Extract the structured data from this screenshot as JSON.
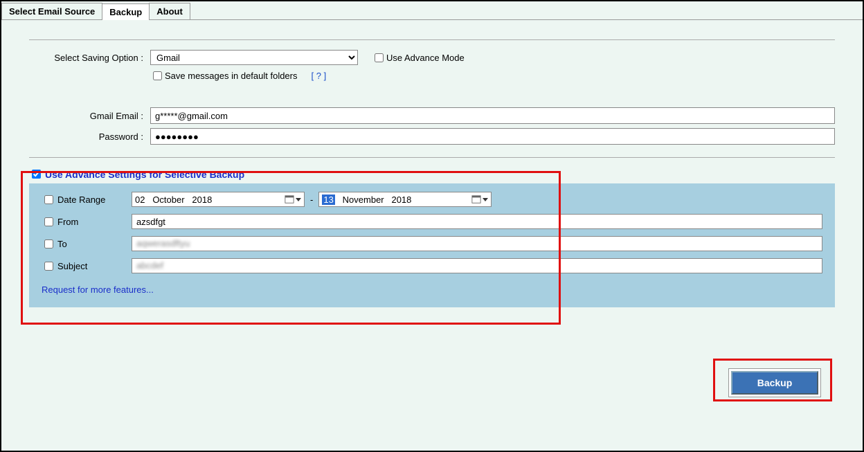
{
  "tabs": {
    "select_source": "Select Email Source",
    "backup": "Backup",
    "about": "About"
  },
  "saving": {
    "label": "Select Saving Option :",
    "value": "Gmail",
    "advance_mode": "Use Advance Mode",
    "save_default": "Save messages in default folders",
    "help": "[ ? ]"
  },
  "cred": {
    "email_label": "Gmail Email :",
    "email_value": "g*****@gmail.com",
    "password_label": "Password :",
    "password_value": "●●●●●●●●"
  },
  "advance": {
    "header": "Use Advance Settings for Selective Backup",
    "date_range": "Date Range",
    "date_from_day": "02",
    "date_from_month": "October",
    "date_from_year": "2018",
    "date_to_day": "13",
    "date_to_month": "November",
    "date_to_year": "2018",
    "from_label": "From",
    "from_value": "azsdfgt",
    "to_label": "To",
    "to_value": "",
    "subject_label": "Subject",
    "subject_value": "",
    "request": "Request for more features..."
  },
  "backup_button": "Backup"
}
